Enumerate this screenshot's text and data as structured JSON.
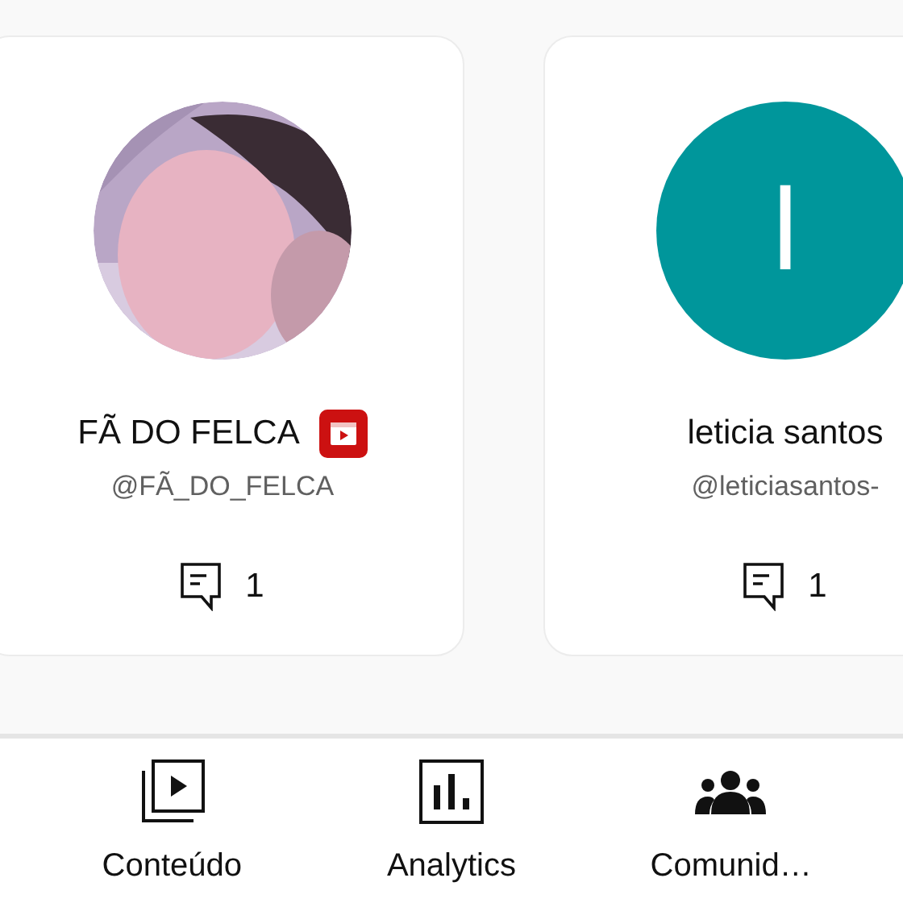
{
  "cards": [
    {
      "name": "FÃ DO FELCA",
      "handle": "@FÃ_DO_FELCA",
      "comments": "1",
      "verified_badge": true
    },
    {
      "name": "leticia santos",
      "handle": "@leticiasantos-",
      "comments": "1",
      "avatar": {
        "kind": "letter",
        "letter": "l",
        "color": "#00969b"
      },
      "verified_badge": false
    }
  ],
  "nav": [
    {
      "label": "Conteúdo",
      "kind": "content"
    },
    {
      "label": "Analytics",
      "kind": "analytics"
    },
    {
      "label": "Comunid…",
      "kind": "community"
    }
  ]
}
